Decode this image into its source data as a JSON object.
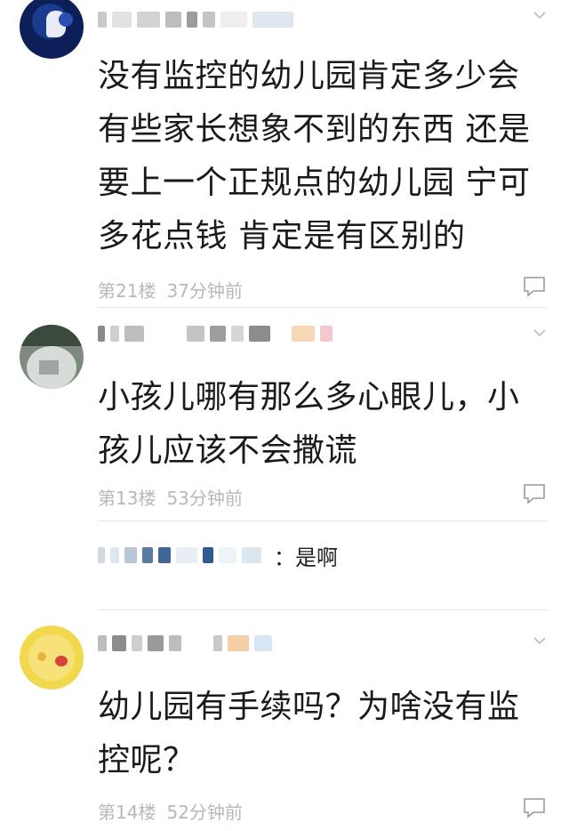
{
  "comments": [
    {
      "text": "没有监控的幼儿园肯定多少会有些家长想象不到的东西 还是要上一个正规点的幼儿园 宁可多花点钱 肯定是有区别的",
      "floor": "第21楼",
      "time": "37分钟前"
    },
    {
      "text": "小孩儿哪有那么多心眼儿，小孩儿应该不会撒谎",
      "floor": "第13楼",
      "time": "53分钟前",
      "reply": {
        "text": "：是啊"
      }
    },
    {
      "text": "幼儿园有手续吗？为啥没有监控呢？",
      "floor": "第14楼",
      "time": "52分钟前"
    }
  ],
  "icons": {
    "chevron": "chevron-down-icon",
    "reply": "comment-bubble-icon"
  },
  "colors": {
    "text": "#1a1a1a",
    "meta": "#b8b8b8",
    "divider": "#e6e6e6"
  }
}
